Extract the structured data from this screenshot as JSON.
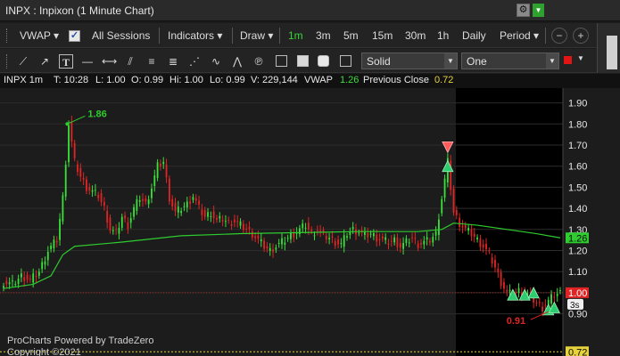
{
  "window": {
    "title": "INPX : Inpixon (1 Minute Chart)"
  },
  "toolbar": {
    "vwap_label": "VWAP",
    "vwap_checked": true,
    "all_sessions": "All Sessions",
    "indicators": "Indicators",
    "draw": "Draw",
    "timeframes": [
      "1m",
      "3m",
      "5m",
      "15m",
      "30m",
      "1h",
      "Daily"
    ],
    "active_timeframe": "1m",
    "period": "Period",
    "line_style": "Solid",
    "line_width": "One",
    "line_color": "#e21414"
  },
  "info": {
    "symbol": "INPX 1m",
    "time": "T: 10:28",
    "low": "L: 1.00",
    "open": "O: 0.99",
    "hi": "Hi: 1.00",
    "lo": "Lo: 0.99",
    "volume": "V: 229,144",
    "vwap_label": "VWAP",
    "vwap_value": "1.26",
    "prev_close_label": "Previous Close",
    "prev_close_value": "0.72"
  },
  "chart_data": {
    "type": "candlestick",
    "y_ticks": [
      0.9,
      1.0,
      1.1,
      1.2,
      1.3,
      1.4,
      1.5,
      1.6,
      1.7,
      1.8,
      1.9
    ],
    "ylim": [
      0.7,
      1.97
    ],
    "price_labels": {
      "vwap": "1.26",
      "current": "1.00",
      "countdown": "3s",
      "prev_close": "0.72"
    },
    "annotations": {
      "high": "1.86",
      "low": "0.91"
    },
    "anchors": [
      [
        0,
        1.05
      ],
      [
        3,
        1.04
      ],
      [
        6,
        1.08
      ],
      [
        9,
        1.06
      ],
      [
        12,
        1.1
      ],
      [
        15,
        1.2
      ],
      [
        18,
        1.25
      ],
      [
        20,
        1.45
      ],
      [
        22,
        1.8
      ],
      [
        24,
        1.62
      ],
      [
        26,
        1.55
      ],
      [
        28,
        1.5
      ],
      [
        30,
        1.48
      ],
      [
        32,
        1.46
      ],
      [
        34,
        1.4
      ],
      [
        36,
        1.3
      ],
      [
        38,
        1.28
      ],
      [
        40,
        1.36
      ],
      [
        42,
        1.32
      ],
      [
        44,
        1.4
      ],
      [
        46,
        1.45
      ],
      [
        48,
        1.42
      ],
      [
        50,
        1.5
      ],
      [
        52,
        1.6
      ],
      [
        54,
        1.62
      ],
      [
        56,
        1.45
      ],
      [
        58,
        1.38
      ],
      [
        60,
        1.4
      ],
      [
        62,
        1.42
      ],
      [
        64,
        1.46
      ],
      [
        66,
        1.4
      ],
      [
        68,
        1.36
      ],
      [
        70,
        1.38
      ],
      [
        72,
        1.34
      ],
      [
        74,
        1.35
      ],
      [
        76,
        1.33
      ],
      [
        78,
        1.34
      ],
      [
        80,
        1.32
      ],
      [
        82,
        1.3
      ],
      [
        84,
        1.28
      ],
      [
        86,
        1.25
      ],
      [
        88,
        1.22
      ],
      [
        90,
        1.2
      ],
      [
        92,
        1.22
      ],
      [
        94,
        1.24
      ],
      [
        96,
        1.26
      ],
      [
        98,
        1.28
      ],
      [
        100,
        1.3
      ],
      [
        102,
        1.32
      ],
      [
        104,
        1.28
      ],
      [
        106,
        1.3
      ],
      [
        108,
        1.27
      ],
      [
        110,
        1.26
      ],
      [
        112,
        1.24
      ],
      [
        114,
        1.23
      ],
      [
        116,
        1.28
      ],
      [
        118,
        1.3
      ],
      [
        120,
        1.29
      ],
      [
        122,
        1.27
      ],
      [
        124,
        1.28
      ],
      [
        126,
        1.26
      ],
      [
        128,
        1.25
      ],
      [
        130,
        1.24
      ],
      [
        132,
        1.25
      ],
      [
        134,
        1.22
      ],
      [
        136,
        1.24
      ],
      [
        138,
        1.26
      ],
      [
        140,
        1.23
      ],
      [
        142,
        1.24
      ],
      [
        144,
        1.25
      ],
      [
        146,
        1.28
      ],
      [
        148,
        1.45
      ],
      [
        150,
        1.62
      ],
      [
        152,
        1.38
      ],
      [
        154,
        1.33
      ],
      [
        156,
        1.3
      ],
      [
        158,
        1.28
      ],
      [
        160,
        1.25
      ],
      [
        162,
        1.22
      ],
      [
        164,
        1.18
      ],
      [
        166,
        1.12
      ],
      [
        168,
        1.05
      ],
      [
        170,
        1.0
      ],
      [
        172,
        0.99
      ],
      [
        174,
        1.01
      ],
      [
        176,
        1.0
      ],
      [
        178,
        0.98
      ],
      [
        180,
        0.95
      ],
      [
        182,
        0.93
      ],
      [
        184,
        0.96
      ],
      [
        186,
        0.99
      ],
      [
        188,
        1.0
      ]
    ],
    "vwap_line": [
      [
        0,
        1.02
      ],
      [
        10,
        1.04
      ],
      [
        16,
        1.08
      ],
      [
        20,
        1.18
      ],
      [
        24,
        1.22
      ],
      [
        40,
        1.24
      ],
      [
        60,
        1.27
      ],
      [
        80,
        1.28
      ],
      [
        100,
        1.285
      ],
      [
        120,
        1.29
      ],
      [
        140,
        1.29
      ],
      [
        148,
        1.3
      ],
      [
        152,
        1.33
      ],
      [
        160,
        1.32
      ],
      [
        170,
        1.3
      ],
      [
        180,
        1.28
      ],
      [
        188,
        1.26
      ]
    ]
  },
  "footer": {
    "powered": "ProCharts Powered by TradeZero",
    "copyright": "Copyright ©2021"
  }
}
